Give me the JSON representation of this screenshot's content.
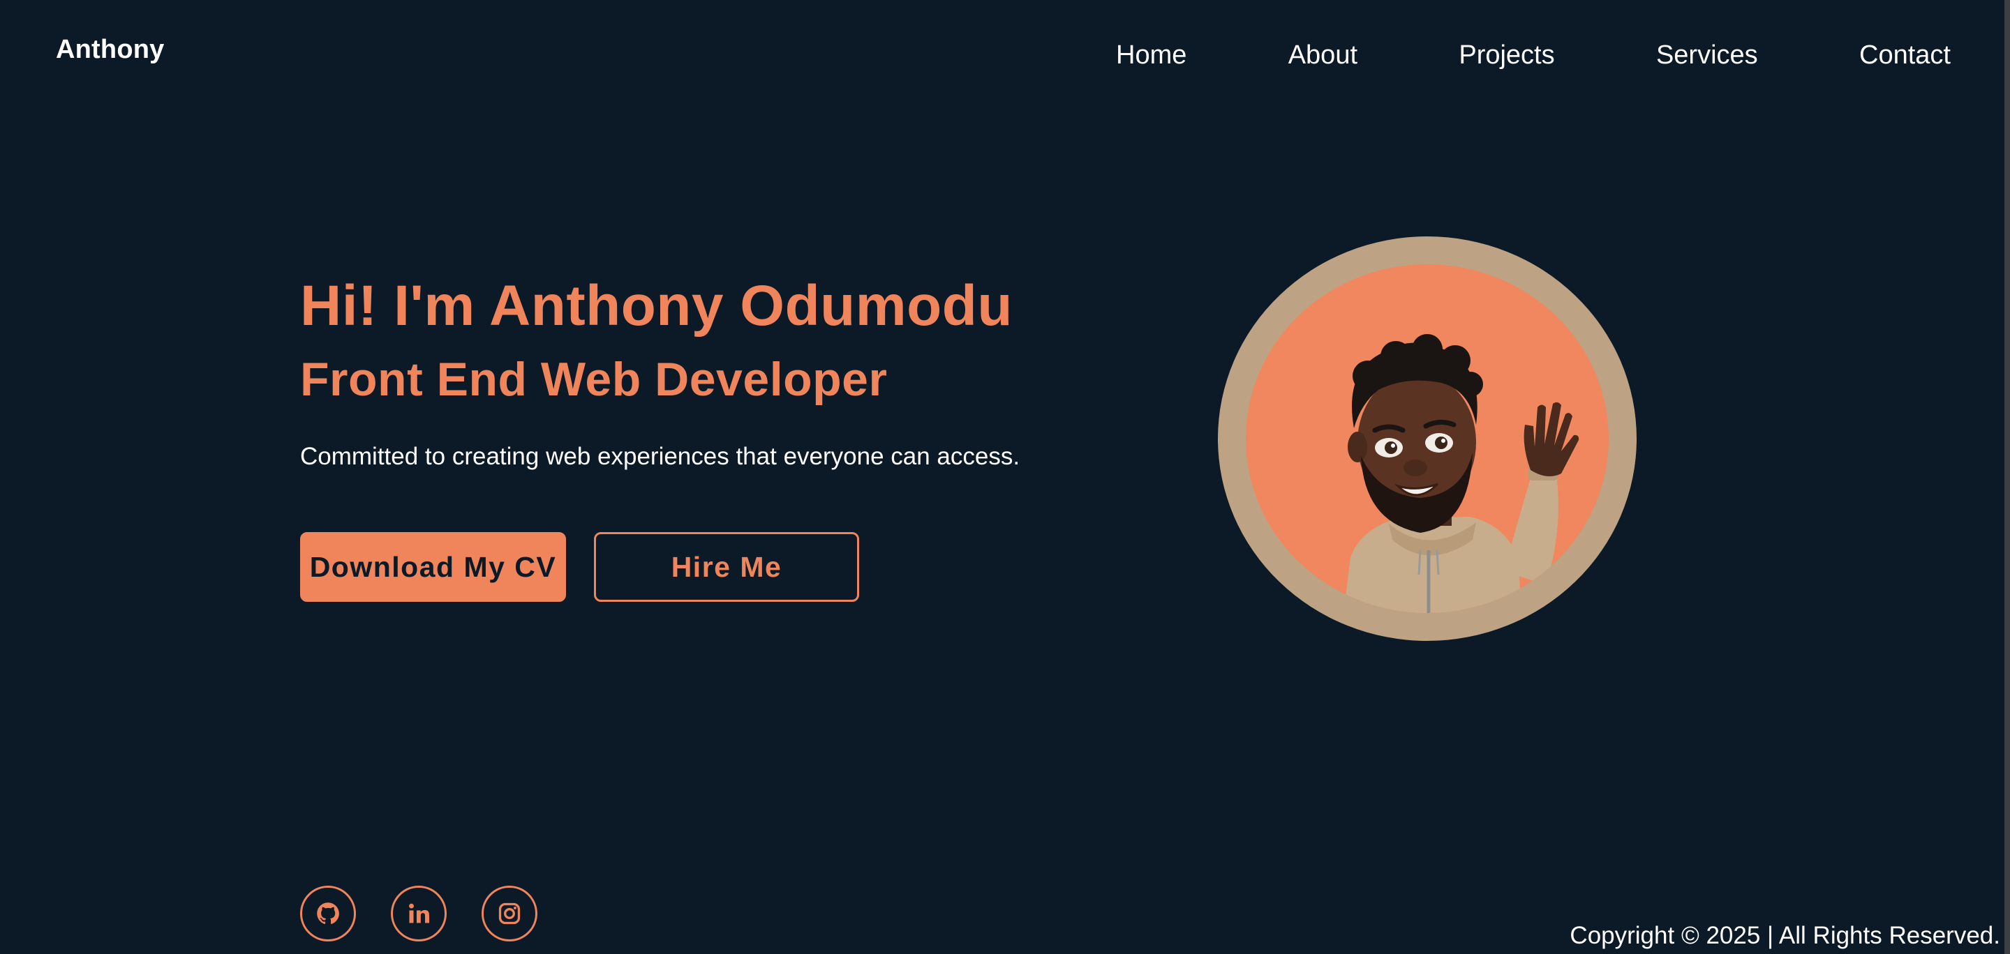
{
  "header": {
    "logo": "Anthony",
    "nav": [
      "Home",
      "About",
      "Projects",
      "Services",
      "Contact"
    ]
  },
  "hero": {
    "title": "Hi! I'm Anthony Odumodu",
    "subtitle": "Front End Web Developer",
    "description": "Committed to creating web experiences that everyone can access.",
    "primary_button": "Download My CV",
    "secondary_button": "Hire Me"
  },
  "socials": {
    "icons": [
      "github-icon",
      "linkedin-icon",
      "instagram-icon"
    ]
  },
  "footer": {
    "copyright": "Copyright © 2025 | All Rights Reserved."
  },
  "colors": {
    "background": "#0b1a26",
    "accent": "#f0855b",
    "avatar_ring": "#bda383",
    "text": "#ffffff"
  }
}
